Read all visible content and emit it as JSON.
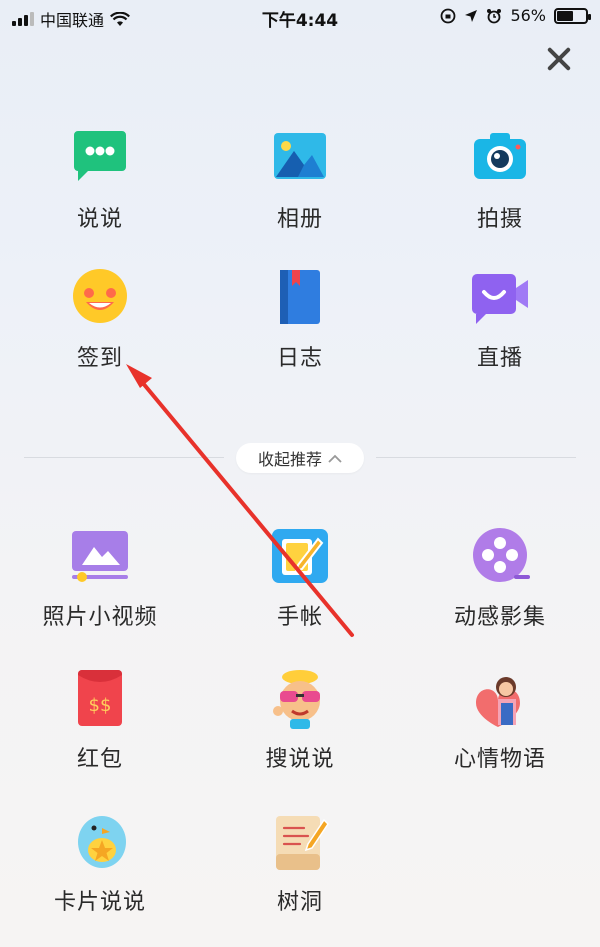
{
  "status_bar": {
    "carrier": "中国联通",
    "time": "下午4:44",
    "battery_percent": "56%",
    "battery_level": 0.56,
    "icons": [
      "signal-icon",
      "wifi-icon",
      "rotation-lock-icon",
      "location-icon",
      "alarm-icon",
      "battery-icon"
    ]
  },
  "top_grid": [
    {
      "label": "说说",
      "icon": "chat-bubble-icon"
    },
    {
      "label": "相册",
      "icon": "photo-album-icon"
    },
    {
      "label": "拍摄",
      "icon": "camera-icon"
    },
    {
      "label": "签到",
      "icon": "smiley-face-icon"
    },
    {
      "label": "日志",
      "icon": "journal-book-icon"
    },
    {
      "label": "直播",
      "icon": "live-video-icon"
    }
  ],
  "collapse": {
    "label": "收起推荐",
    "icon": "chevron-up-icon"
  },
  "bottom_grid": [
    {
      "label": "照片小视频",
      "icon": "photo-video-icon"
    },
    {
      "label": "手帐",
      "icon": "notebook-pen-icon"
    },
    {
      "label": "动感影集",
      "icon": "film-reel-icon"
    },
    {
      "label": "红包",
      "icon": "red-envelope-icon"
    },
    {
      "label": "搜说说",
      "icon": "sunglasses-character-icon"
    },
    {
      "label": "心情物语",
      "icon": "mood-girl-icon"
    },
    {
      "label": "卡片说说",
      "icon": "card-bird-icon"
    },
    {
      "label": "树洞",
      "icon": "tree-hole-note-icon"
    }
  ],
  "colors": {
    "arrow": "#e8322b",
    "chat_green": "#1fc27d",
    "camera_teal": "#1ab6e6",
    "smiley_yellow": "#ffc928",
    "journal_blue": "#2f7de0",
    "live_purple": "#8f62f0",
    "red_envelope": "#f0444c"
  }
}
